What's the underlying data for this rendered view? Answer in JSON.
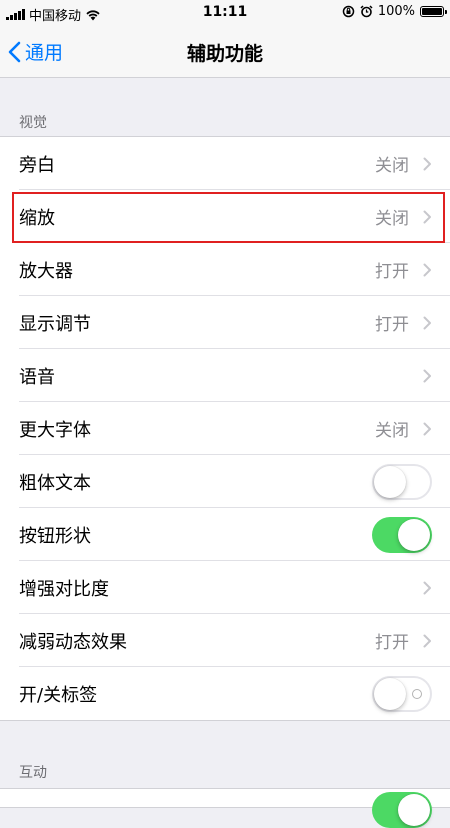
{
  "status_bar": {
    "carrier": "中国移动",
    "time": "11:11",
    "battery": "100%"
  },
  "nav": {
    "back_label": "通用",
    "title": "辅助功能"
  },
  "sections": {
    "vision_header": "视觉",
    "interaction_header": "互动"
  },
  "rows": [
    {
      "label": "旁白",
      "value": "关闭",
      "kind": "disclosure"
    },
    {
      "label": "缩放",
      "value": "关闭",
      "kind": "disclosure"
    },
    {
      "label": "放大器",
      "value": "打开",
      "kind": "disclosure"
    },
    {
      "label": "显示调节",
      "value": "打开",
      "kind": "disclosure"
    },
    {
      "label": "语音",
      "value": "",
      "kind": "disclosure"
    },
    {
      "label": "更大字体",
      "value": "关闭",
      "kind": "disclosure"
    },
    {
      "label": "粗体文本",
      "kind": "toggle",
      "on": false
    },
    {
      "label": "按钮形状",
      "kind": "toggle",
      "on": true
    },
    {
      "label": "增强对比度",
      "value": "",
      "kind": "disclosure"
    },
    {
      "label": "减弱动态效果",
      "value": "打开",
      "kind": "disclosure"
    },
    {
      "label": "开/关标签",
      "kind": "toggle",
      "on": false
    }
  ],
  "colors": {
    "accent": "#007aff",
    "toggle_on": "#4cd964",
    "highlight": "#e02020"
  }
}
